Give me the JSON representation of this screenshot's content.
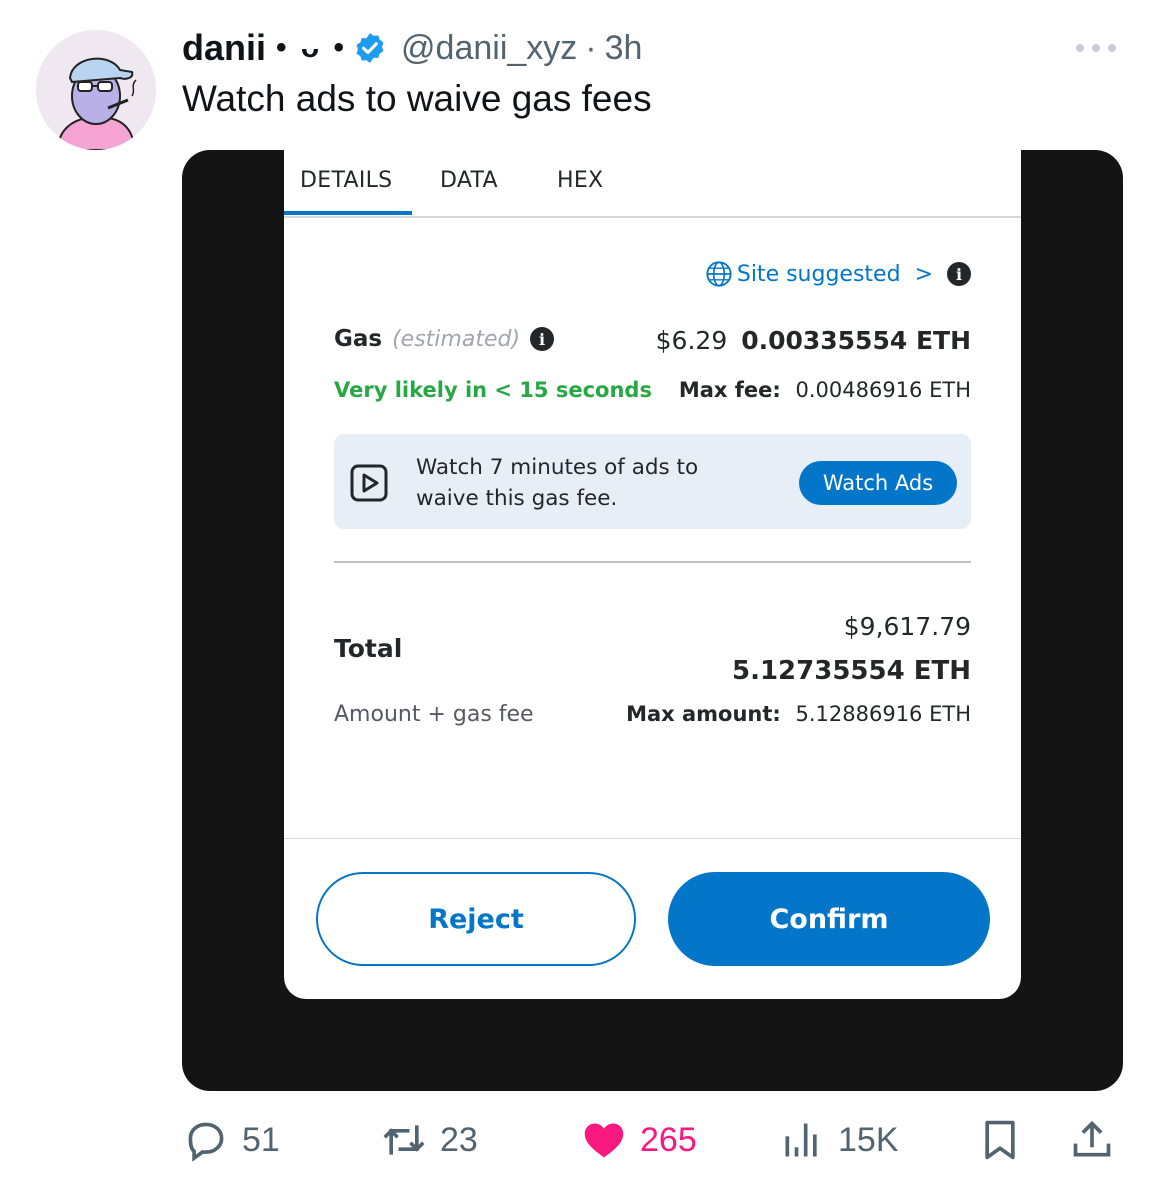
{
  "tweet": {
    "name": "danii",
    "name_deco": "• ᴗ •",
    "handle": "@danii_xyz",
    "separator": "·",
    "time": "3h",
    "text": "Watch ads to waive gas fees"
  },
  "wallet": {
    "tabs": [
      "DETAILS",
      "DATA",
      "HEX"
    ],
    "active_tab": "DETAILS",
    "site_suggested": "Site suggested",
    "gas_label": "Gas",
    "gas_estimated": "(estimated)",
    "gas_usd": "$6.29",
    "gas_eth": "0.00335554 ETH",
    "likely": "Very likely in < 15 seconds",
    "max_fee_label": "Max fee:",
    "max_fee_value": "0.00486916 ETH",
    "ad_text": "Watch 7 minutes of ads to waive this gas fee.",
    "watch_ads": "Watch Ads",
    "total_label": "Total",
    "total_usd": "$9,617.79",
    "total_eth": "5.12735554 ETH",
    "amount_label": "Amount + gas fee",
    "max_amount_label": "Max amount:",
    "max_amount_value": "5.12886916 ETH",
    "reject": "Reject",
    "confirm": "Confirm"
  },
  "actions": {
    "replies": "51",
    "retweets": "23",
    "likes": "265",
    "views": "15K"
  },
  "colors": {
    "accent": "#0376c9",
    "success": "#28a745",
    "like": "#f91880",
    "verified": "#1d9bf0",
    "muted": "#536471"
  },
  "icons": [
    "more-icon",
    "verified-badge-icon",
    "globe-icon",
    "chevron-right-icon",
    "info-icon",
    "play-icon",
    "reply-icon",
    "retweet-icon",
    "heart-icon",
    "views-icon",
    "bookmark-icon",
    "share-icon"
  ]
}
